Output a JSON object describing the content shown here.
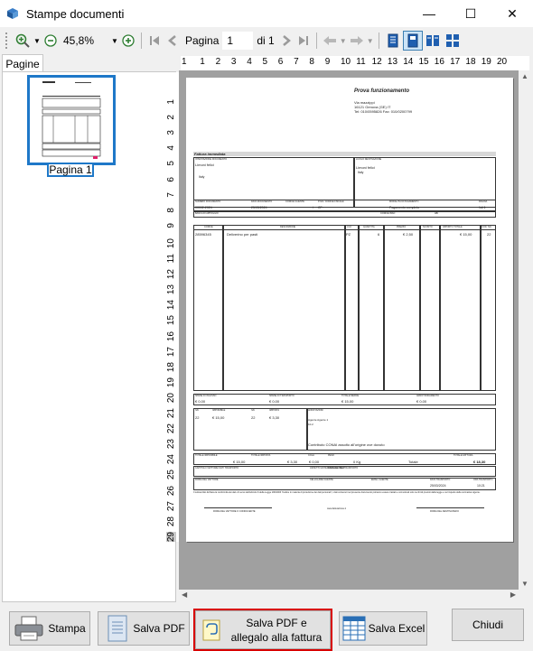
{
  "window": {
    "title": "Stampe documenti",
    "minimize": "—",
    "maximize": "☐",
    "close": "✕"
  },
  "toolbar": {
    "zoom": "45,8%",
    "page_label": "Pagina",
    "page_value": "1",
    "of_label": "di 1"
  },
  "sidebar": {
    "tab": "Pagine",
    "thumb_label": "Pagina 1"
  },
  "ruler": {
    "top": [
      "1",
      "1",
      "2",
      "3",
      "4",
      "5",
      "6",
      "7",
      "8",
      "9",
      "10",
      "11",
      "12",
      "13",
      "14",
      "15",
      "16",
      "17",
      "18",
      "19",
      "20"
    ],
    "left": [
      "1",
      "2",
      "3",
      "4",
      "5",
      "6",
      "7",
      "8",
      "9",
      "10",
      "11",
      "12",
      "13",
      "14",
      "15",
      "16",
      "17",
      "18",
      "19",
      "20",
      "21",
      "22",
      "23",
      "24",
      "25",
      "26",
      "27",
      "28",
      "29"
    ]
  },
  "doc": {
    "title": "Prova funzionamento",
    "addr1": "Via mazzippi",
    "addr2": "16121 Genova (GE) IT",
    "addr3": "Tel: 010/0595826 Fax: 010/0200799",
    "doc_type": "Fattura immediata",
    "dest_h": "INTESTAZIONE DOCUMENTO",
    "dest_name": "Limoni felici",
    "dest_country": "Italy",
    "goods_h": "LUOGO DESTINAZIONE",
    "goods_name": "Limoni felici",
    "goods_country": "Italy",
    "num_h": "NUMERO DOCUMENTO",
    "num_v": "00002-2024",
    "date_h": "DATA DOCUMENTO",
    "date_v": "25/03/2024",
    "client_h": "CODICE CLIENTE",
    "client_v": "/",
    "vat_h": "P.IVA / CODICE FISCALE",
    "vat_v": "CF:",
    "pay_h": "MODALITÀ DI PAGAMENTO",
    "pay_v": "Pagamento completo",
    "page_h": "PAGINA",
    "page_v": "1di 1",
    "bank_h": "BANCA DI APPOGGIO",
    "iban_h": "CODICE IBAN",
    "abi_h": "ABI",
    "col_code": "CODICE",
    "col_desc": "DESCRIZIONE",
    "col_um": "U.M.",
    "col_qty": "QUANTITÀ",
    "col_price": "PREZZO",
    "col_disc": "SCONTO",
    "col_total": "IMPORTO TOTALE",
    "col_vat": "COD. IVA",
    "row_code": "28596345",
    "row_desc": "Deliverino per pasti",
    "row_um": "PZ",
    "row_qty": "6",
    "row_price": "€ 2,50",
    "row_total": "€ 15,00",
    "row_vat": "22",
    "s1_h": "SPESE DI INCASSO",
    "s1_v": "€ 0,00",
    "s2_h": "SPESE DI TRASPORTO",
    "s2_v": "€ 0,00",
    "s3_h": "TOTALE MERCE",
    "s3_v": "€ 15,00",
    "s4_h": "ARROTONDAMENTO",
    "s4_v": "€ 0,00",
    "iva_h1": "IVA",
    "iva_h2": "IMPONIBILE",
    "iva_h3": "IVA",
    "iva_h4": "IMPOSTA",
    "iva_v1": "22",
    "iva_v2": "€ 15,00",
    "iva_v3": "22",
    "iva_v4": "€ 3,30",
    "notes_h": "ANNOTAZIONI",
    "notes_1": "Agente Agente 1",
    "notes_2": "10.2",
    "conai": "Contributo CONAI assolto all'origine ove dovuto",
    "tot_imp_h": "TOTALE IMPONIBILE",
    "tot_imp_v": "€ 15,00",
    "tot_iva_h": "TOTALE IMPOSTA",
    "tot_iva_v": "€ 3,30",
    "colli_h": "COLLI",
    "colli_v": "€ 0,00",
    "peso_h": "PESO",
    "peso_v": "0 Kg",
    "totale_label": "Totale",
    "grand_h": "TOTALE FATTURA",
    "grand_v": "€ 18,30",
    "carrier_h": "CAPITOLO VETTORE/ DATI TRASPORTO",
    "aspect_h": "ASPETTO ESTERIORE DEI BENI",
    "goods_cause_h": "CAUSALE DEL TRASPORTO",
    "notes2_h": "FIRMA DEL VETTORE",
    "cellular_h": "CELLULARE CLIENTE",
    "email_h": "EMAIL CLIENTE",
    "due_h": "DATA TRASPORTO",
    "due_v": "25/03/2024",
    "time_h": "ORA TRASPORTO",
    "time_v": "10:21",
    "legal": "Il sottoscritto dichiara la conformità dei dati. Ai sensi dell'articolo 6 della Legge 196/2003 'Codice in materia di protezione dei dati personali', i dati contenuti nel presente documento potranno essere trattati e comunicati solo nei limiti previsti dalla legge e nel rispetto della normativa vigente.",
    "sign1": "FIRMA DEL VETTORE O CONDUCENTE",
    "sign2": "FIRMA DEL DESTINATARIO",
    "website": "www.fatturazione.it"
  },
  "buttons": {
    "print": "Stampa",
    "save_pdf": "Salva PDF",
    "save_attach_1": "Salva PDF e",
    "save_attach_2": "allegalo alla fattura",
    "save_excel": "Salva Excel",
    "close": "Chiudi"
  },
  "colors": {
    "accent": "#1e78c8",
    "highlight": "#d80000",
    "viewer_bg": "#a0a0a0"
  },
  "icons": [
    "app-icon",
    "zoom-in-icon",
    "zoom-out-icon",
    "zoom-plus-icon",
    "first-page-icon",
    "prev-page-icon",
    "next-page-icon",
    "last-page-icon",
    "back-icon",
    "forward-icon",
    "single-page-icon",
    "fit-page-icon",
    "two-pages-icon",
    "four-pages-icon",
    "printer-icon",
    "pdf-file-icon",
    "attach-icon",
    "excel-grid-icon"
  ]
}
